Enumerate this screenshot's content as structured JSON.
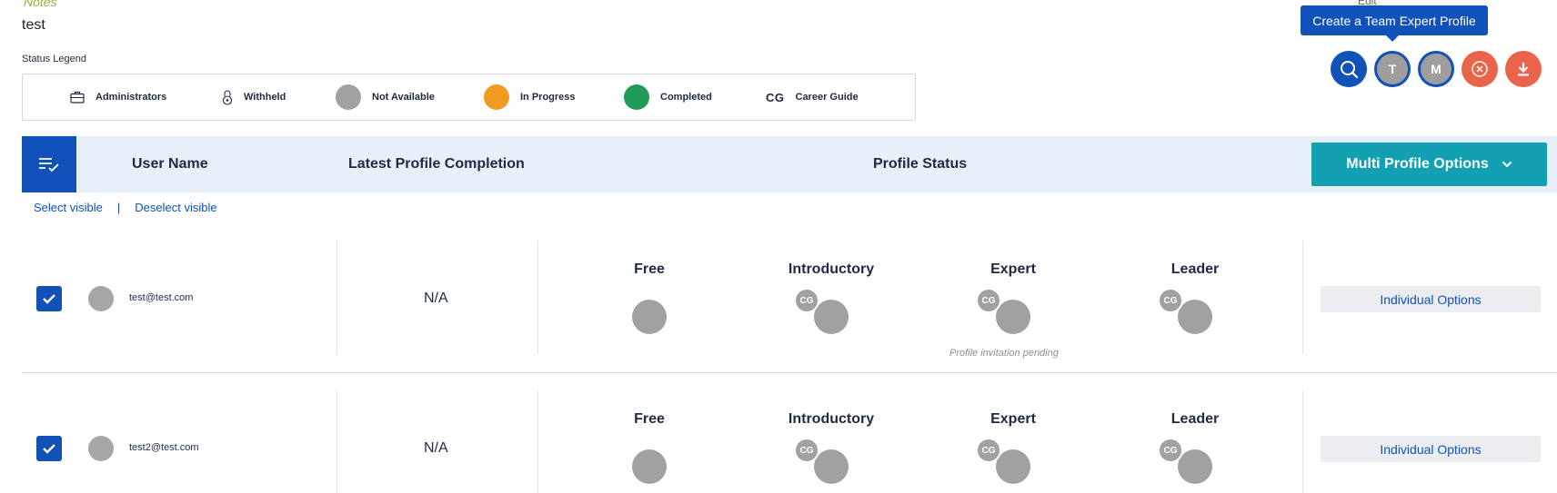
{
  "notes": {
    "label": "Notes",
    "value": "test",
    "edit_label": "Edit"
  },
  "legend": {
    "title": "Status Legend",
    "items": [
      {
        "icon": "briefcase-icon",
        "label": "Administrators"
      },
      {
        "icon": "lock-icon",
        "label": "Withheld"
      },
      {
        "icon": "grey-dot",
        "label": "Not Available",
        "color": "#a1a1a1"
      },
      {
        "icon": "orange-dot",
        "label": "In Progress",
        "color": "#f29b22"
      },
      {
        "icon": "green-dot",
        "label": "Completed",
        "color": "#1f9b57"
      },
      {
        "icon": "cg-text",
        "symbol": "CG",
        "label": "Career Guide"
      }
    ]
  },
  "tooltip": "Create a Team Expert Profile",
  "actions": {
    "team_letter": "T",
    "multi_letter": "M"
  },
  "table": {
    "headers": {
      "user_name": "User Name",
      "latest_completion": "Latest Profile Completion",
      "profile_status": "Profile Status"
    },
    "multi_options_label": "Multi Profile Options",
    "select_visible": "Select visible",
    "separator": "|",
    "deselect_visible": "Deselect visible",
    "tiers": [
      "Free",
      "Introductory",
      "Expert",
      "Leader"
    ],
    "cg_badge": "CG",
    "individual_options_label": "Individual Options",
    "rows": [
      {
        "email": "test@test.com",
        "completion": "N/A",
        "checked": true,
        "note": "Profile invitation pending"
      },
      {
        "email": "test2@test.com",
        "completion": "N/A",
        "checked": true,
        "note": ""
      }
    ]
  },
  "colors": {
    "primary": "#1052b8",
    "teal": "#13a0b2",
    "danger": "#e9644a",
    "grey": "#a1a1a1"
  }
}
